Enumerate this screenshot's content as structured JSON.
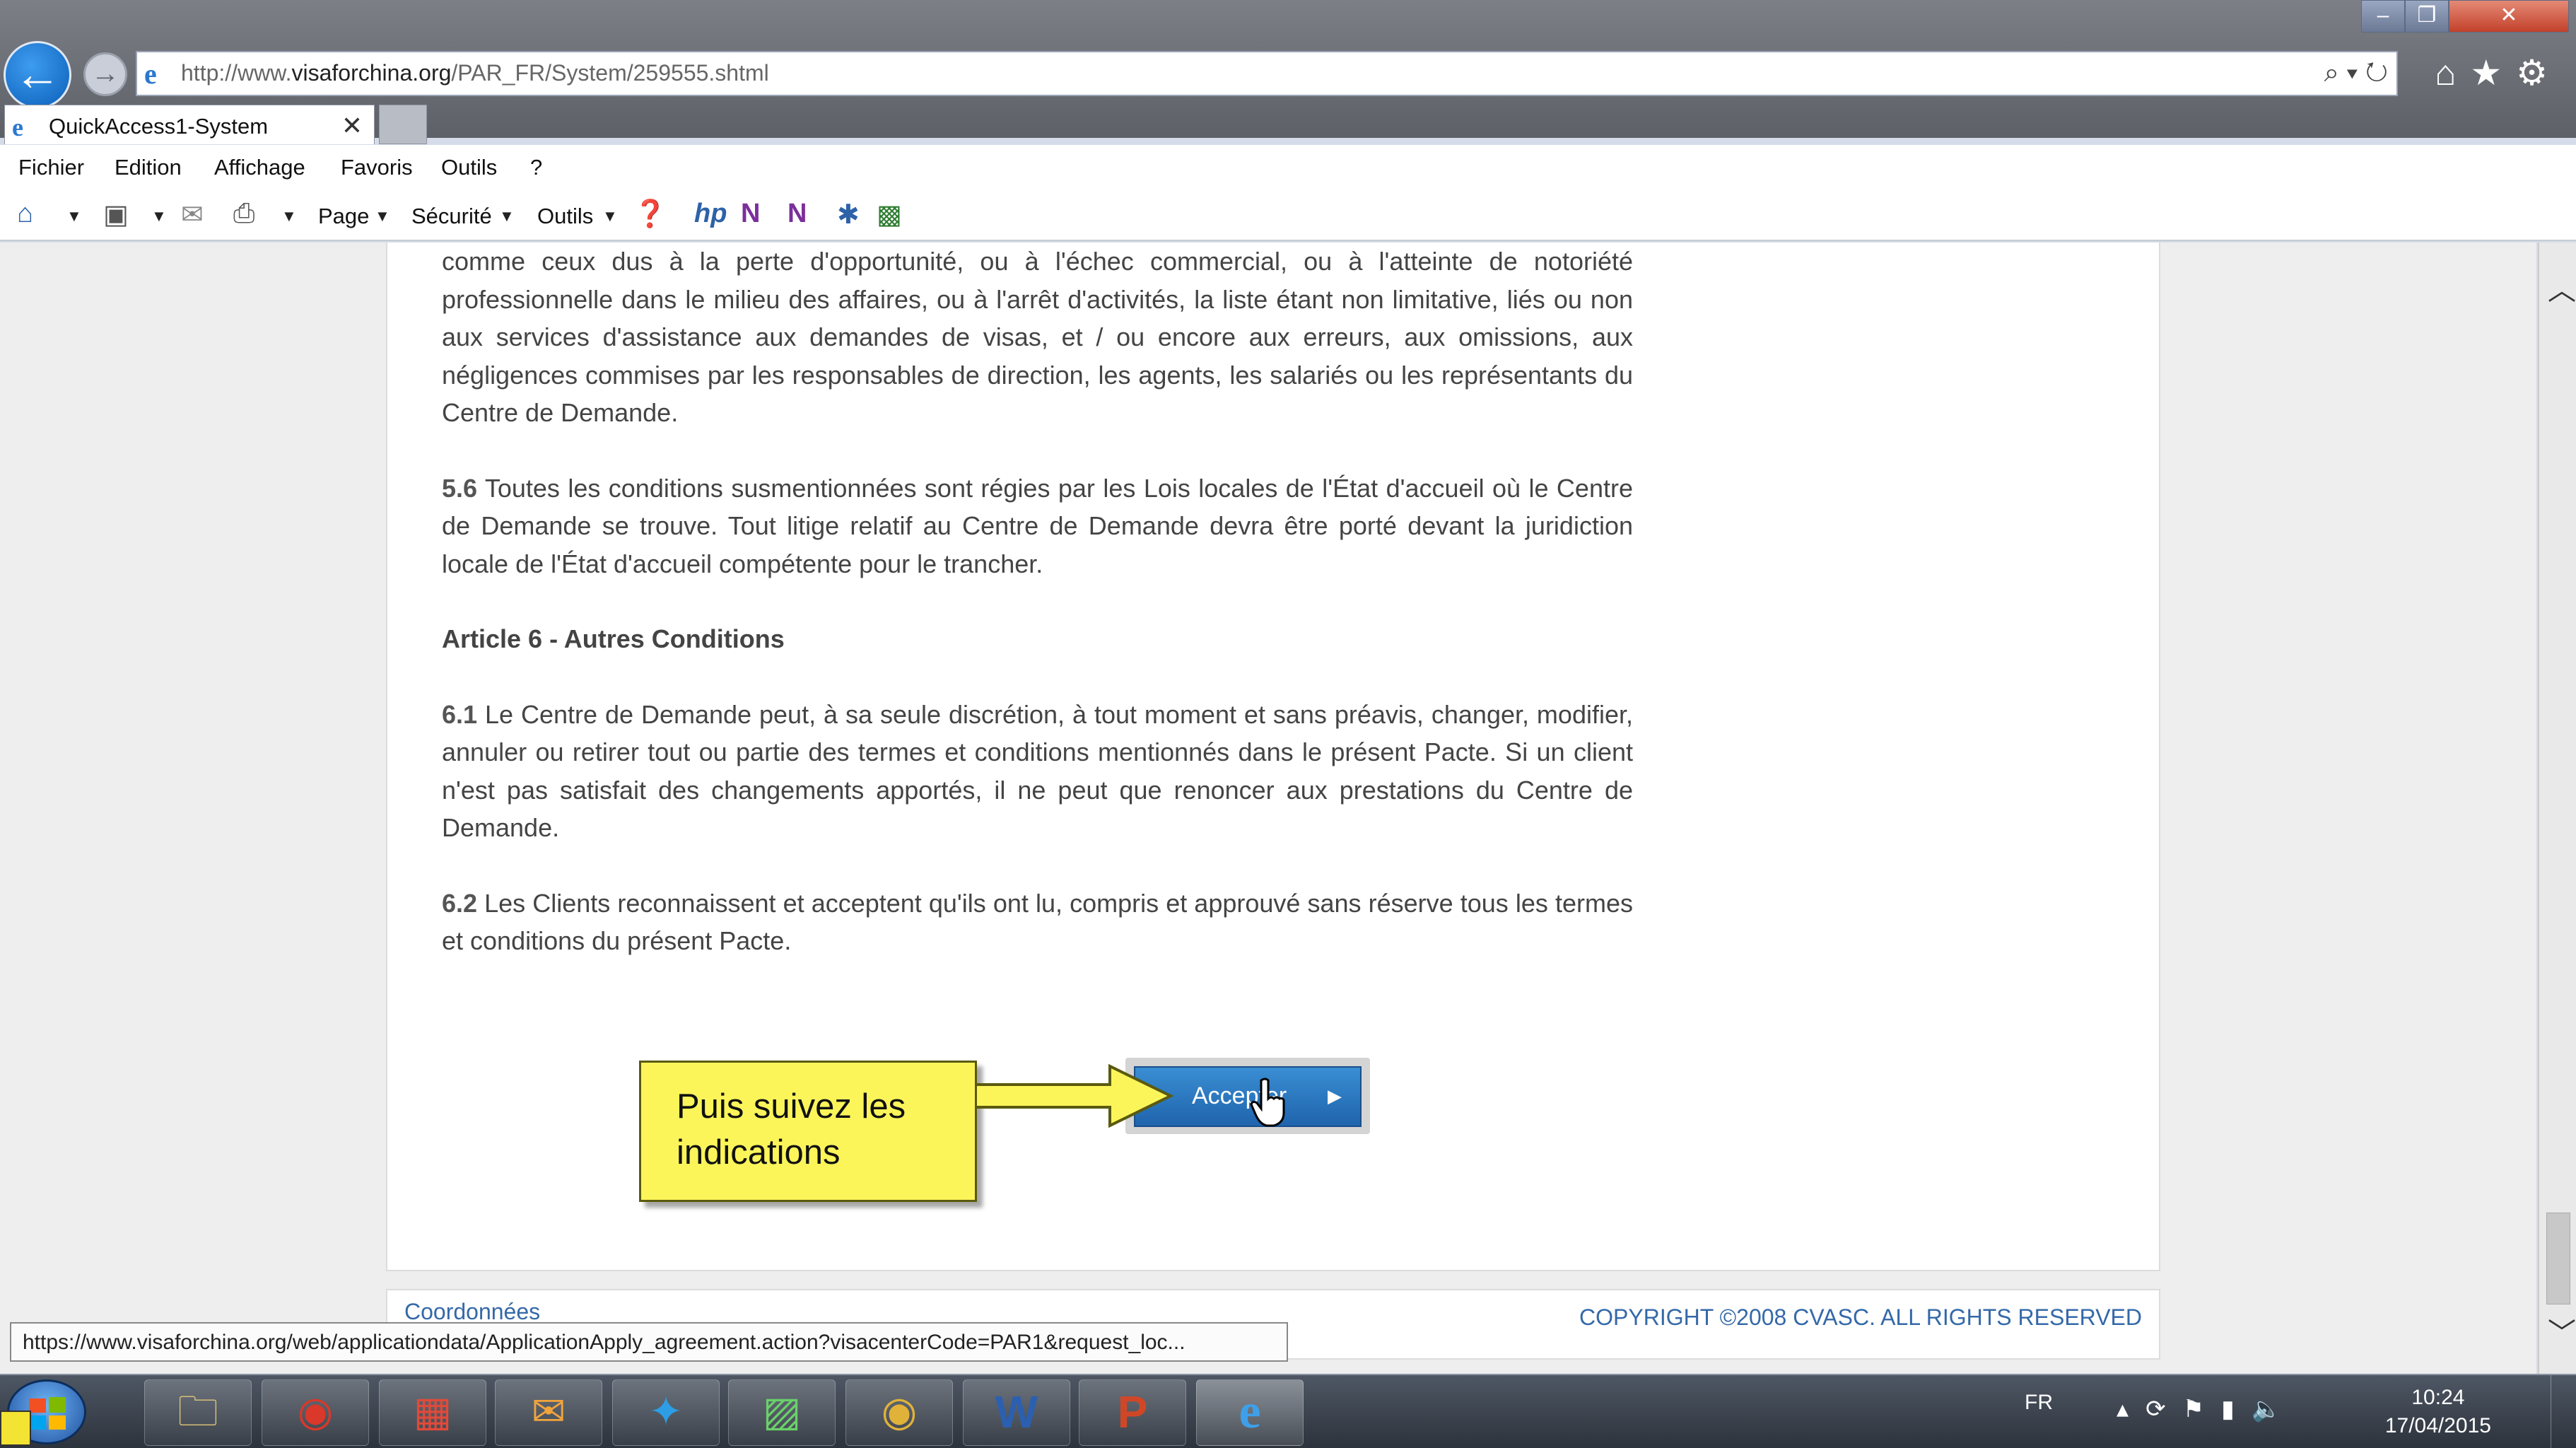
{
  "browser": {
    "url_prefix": "http://www.",
    "url_domain": "visaforchina.org",
    "url_path": "/PAR_FR/System/259555.shtml",
    "tab_title": "QuickAccess1-System",
    "menu": [
      "Fichier",
      "Edition",
      "Affichage",
      "Favoris",
      "Outils",
      "?"
    ],
    "commands": {
      "page": "Page",
      "securite": "Sécurité",
      "outils": "Outils"
    }
  },
  "content": {
    "para_intro": "comme ceux dus à la perte d'opportunité, ou à l'échec commercial, ou à l'atteinte de notoriété professionnelle dans le milieu des affaires, ou à l'arrêt d'activités, la liste étant non limitative, liés ou non aux services d'assistance aux demandes de visas, et / ou encore aux erreurs, aux omissions, aux négligences commises par les responsables de direction, les agents, les salariés ou les représentants du Centre de Demande.",
    "p56_num": "5.6",
    "p56_text": " Toutes les conditions susmentionnées sont régies par les Lois locales de l'État d'accueil où le Centre de Demande se trouve. Tout litige relatif au Centre de Demande devra être porté devant la juridiction locale de l'État d'accueil compétente pour le trancher.",
    "article6_title": "Article 6 - Autres Conditions",
    "p61_num": "6.1",
    "p61_text": " Le Centre de Demande peut, à sa seule discrétion, à tout moment et sans préavis, changer, modifier, annuler ou retirer tout ou partie des termes et conditions mentionnés dans le présent Pacte. Si un client n'est pas satisfait des changements apportés, il ne peut que renoncer aux prestations du Centre de Demande.",
    "p62_num": "6.2",
    "p62_text": " Les Clients reconnaissent et acceptent qu'ils ont lu, compris et approuvé sans réserve tous les termes et conditions du présent Pacte."
  },
  "accept_button": {
    "label": "Accepter"
  },
  "callout": {
    "text": "Puis suivez les indications"
  },
  "footer": {
    "coordonnees": "Coordonnées",
    "copyright": "COPYRIGHT ©2008 CVASC. ALL RIGHTS RESERVED"
  },
  "status_url": "https://www.visaforchina.org/web/applicationdata/ApplicationApply_agreement.action?visacenterCode=PAR1&request_loc...",
  "taskbar": {
    "lang": "FR",
    "time": "10:24",
    "date": "17/04/2015",
    "apps": [
      "explorer-icon",
      "chrome-user-icon",
      "apps-grid-icon",
      "outlook-icon",
      "twitter-icon",
      "media-icon",
      "chrome-icon",
      "word-icon",
      "powerpoint-icon",
      "ie-icon"
    ]
  }
}
